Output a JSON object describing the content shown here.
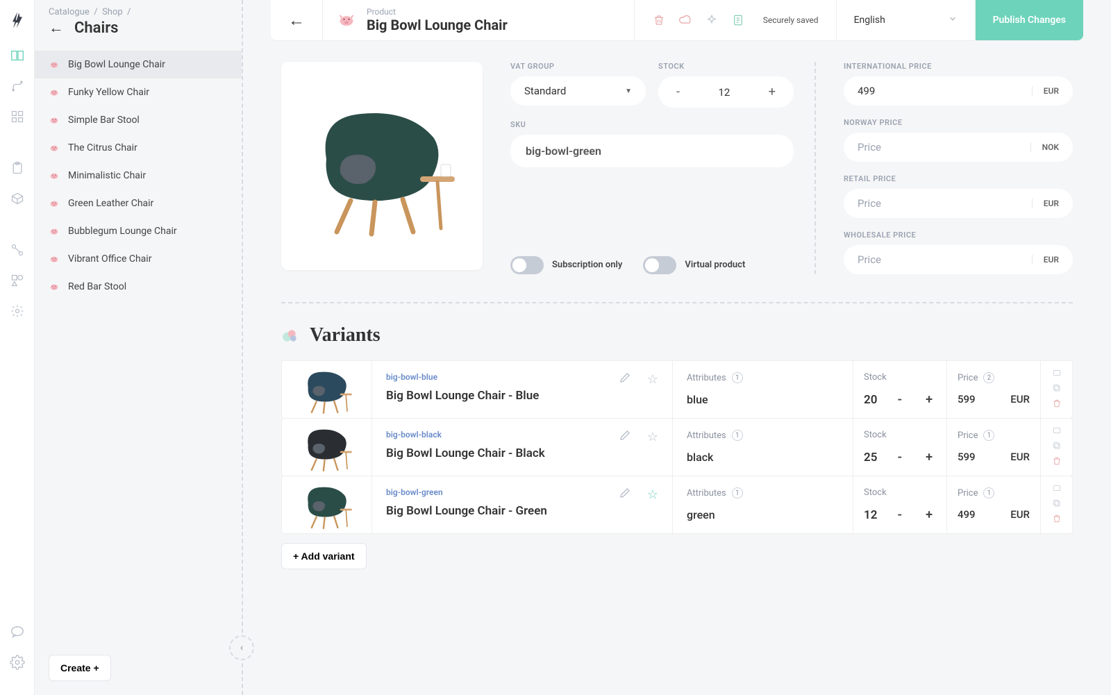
{
  "breadcrumb": {
    "part1": "Catalogue",
    "part2": "Shop"
  },
  "sidebar": {
    "title": "Chairs",
    "items": [
      {
        "label": "Big Bowl Lounge Chair",
        "active": true
      },
      {
        "label": "Funky Yellow Chair"
      },
      {
        "label": "Simple Bar Stool"
      },
      {
        "label": "The Citrus Chair"
      },
      {
        "label": "Minimalistic Chair"
      },
      {
        "label": "Green Leather Chair"
      },
      {
        "label": "Bubblegum Lounge Chair"
      },
      {
        "label": "Vibrant Office Chair"
      },
      {
        "label": "Red Bar Stool"
      }
    ],
    "create_label": "Create +"
  },
  "topbar": {
    "product_label": "Product",
    "product_title": "Big Bowl Lounge Chair",
    "saved_text": "Securely saved",
    "language": "English",
    "publish_label": "Publish Changes"
  },
  "details": {
    "vat_group_label": "VAT GROUP",
    "vat_group_value": "Standard",
    "stock_label": "STOCK",
    "stock_value": "12",
    "sku_label": "SKU",
    "sku_value": "big-bowl-green",
    "toggle_sub": "Subscription only",
    "toggle_virt": "Virtual product"
  },
  "prices": [
    {
      "label": "INTERNATIONAL PRICE",
      "value": "499",
      "currency": "EUR",
      "has_value": true
    },
    {
      "label": "NORWAY PRICE",
      "value": "Price",
      "currency": "NOK",
      "has_value": false
    },
    {
      "label": "RETAIL PRICE",
      "value": "Price",
      "currency": "EUR",
      "has_value": false
    },
    {
      "label": "WHOLESALE PRICE",
      "value": "Price",
      "currency": "EUR",
      "has_value": false
    }
  ],
  "variants": {
    "title": "Variants",
    "attr_label": "Attributes",
    "stock_label": "Stock",
    "price_label": "Price",
    "add_label": "+ Add variant",
    "rows": [
      {
        "sku": "big-bowl-blue",
        "name": "Big Bowl Lounge Chair - Blue",
        "attr": "blue",
        "attr_count": "1",
        "stock": "20",
        "price": "599",
        "currency": "EUR",
        "price_count": "2",
        "star": false,
        "color": "#2b4a5e"
      },
      {
        "sku": "big-bowl-black",
        "name": "Big Bowl Lounge Chair - Black",
        "attr": "black",
        "attr_count": "1",
        "stock": "25",
        "price": "599",
        "currency": "EUR",
        "price_count": "1",
        "star": false,
        "color": "#2a2e33"
      },
      {
        "sku": "big-bowl-green",
        "name": "Big Bowl Lounge Chair - Green",
        "attr": "green",
        "attr_count": "1",
        "stock": "12",
        "price": "499",
        "currency": "EUR",
        "price_count": "1",
        "star": true,
        "color": "#2b4d48"
      }
    ]
  }
}
